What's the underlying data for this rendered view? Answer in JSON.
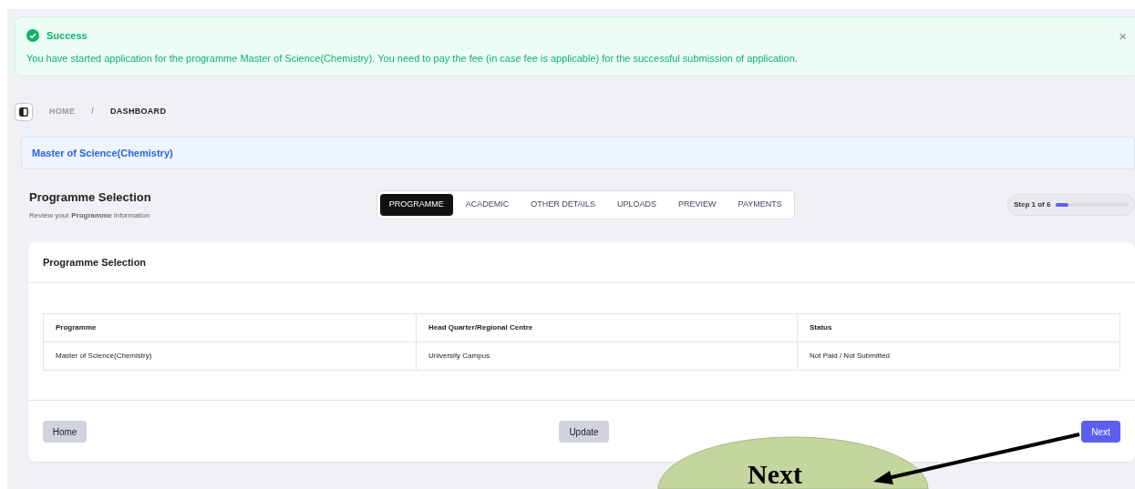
{
  "alert": {
    "title": "Success",
    "message": "You have started application for the programme Master of Science(Chemistry). You need to pay the fee (in case fee is applicable) for the successful submission of application.",
    "close": "×"
  },
  "breadcrumb": [
    {
      "label": "HOME",
      "selected": false
    },
    {
      "label": "DASHBOARD",
      "selected": true
    }
  ],
  "breadcrumb_separator": "/",
  "programme_banner": "Master of Science(Chemistry)",
  "page_header": {
    "title": "Programme Selection",
    "subtitle": "Review your **Programme** information"
  },
  "tabs": [
    {
      "label": "PROGRAMME",
      "selected": true
    },
    {
      "label": "ACADEMIC",
      "selected": false
    },
    {
      "label": "OTHER DETAILS",
      "selected": false
    },
    {
      "label": "UPLOADS",
      "selected": false
    },
    {
      "label": "PREVIEW",
      "selected": false
    },
    {
      "label": "PAYMENTS",
      "selected": false
    }
  ],
  "step": {
    "label": "Step 1 of 6",
    "level": 0.17
  },
  "card": {
    "title": "Programme Selection",
    "table": {
      "columns": [
        "Programme",
        "Head Quarter/Regional Centre",
        "Status"
      ],
      "rows": [
        [
          "Master of Science(Chemistry)",
          "University Campus",
          "Not Paid / Not Submitted"
        ]
      ]
    },
    "buttons": [
      {
        "label": "Home",
        "kind": "secondary"
      },
      {
        "label": "Update",
        "kind": "secondary"
      },
      {
        "label": "Next",
        "kind": "primary"
      }
    ]
  },
  "annotation": {
    "label": "Next"
  }
}
